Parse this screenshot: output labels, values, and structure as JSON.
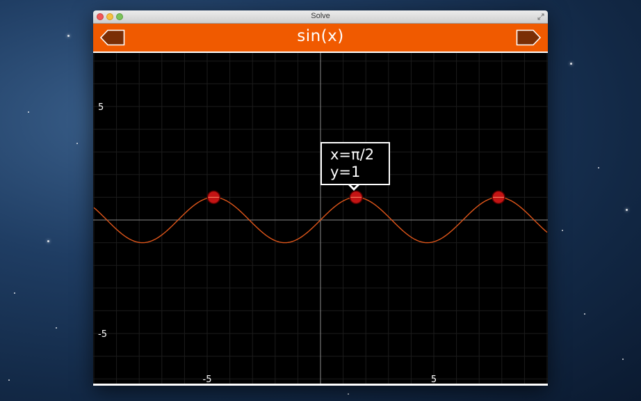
{
  "window": {
    "title": "Solve"
  },
  "toolbar": {
    "function_label": "sin(x)",
    "back_icon": "left-arrow-icon",
    "forward_icon": "right-arrow-icon",
    "accent_color": "#f05a00"
  },
  "tooltip": {
    "x_text": "x=π/2",
    "y_text": "y=1"
  },
  "colors": {
    "curve": "#e0561a",
    "marker": "#c41414",
    "grid": "#1c1c1c",
    "axis": "#8a8a8a"
  },
  "chart_data": {
    "type": "line",
    "function": "sin(x)",
    "xlim": [
      -10,
      10
    ],
    "ylim": [
      -7.3,
      7.3
    ],
    "x_ticks": [
      {
        "value": -5,
        "label": "-5"
      },
      {
        "value": 5,
        "label": "5"
      }
    ],
    "y_ticks": [
      {
        "value": 5,
        "label": "5"
      },
      {
        "value": -5,
        "label": "-5"
      }
    ],
    "grid": true,
    "highlighted_points": [
      {
        "x": -4.712,
        "y": 1
      },
      {
        "x": 1.571,
        "y": 1
      },
      {
        "x": 7.854,
        "y": 1
      }
    ]
  }
}
